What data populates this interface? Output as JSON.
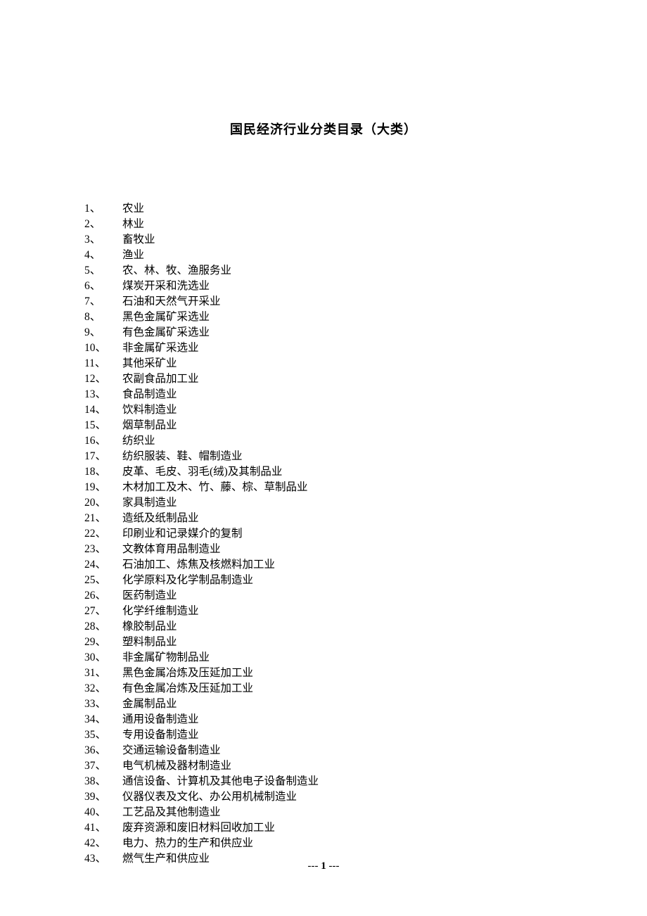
{
  "title": "国民经济行业分类目录（大类）",
  "items": [
    {
      "num": "1、",
      "label": "农业"
    },
    {
      "num": "2、",
      "label": "林业"
    },
    {
      "num": "3、",
      "label": "畜牧业"
    },
    {
      "num": "4、",
      "label": "渔业"
    },
    {
      "num": "5、",
      "label": "农、林、牧、渔服务业"
    },
    {
      "num": "6、",
      "label": "煤炭开采和洗选业"
    },
    {
      "num": "7、",
      "label": "石油和天然气开采业"
    },
    {
      "num": "8、",
      "label": "黑色金属矿采选业"
    },
    {
      "num": "9、",
      "label": "有色金属矿采选业"
    },
    {
      "num": "10、",
      "label": "非金属矿采选业"
    },
    {
      "num": "11、",
      "label": "其他采矿业"
    },
    {
      "num": "12、",
      "label": "农副食品加工业"
    },
    {
      "num": "13、",
      "label": "食品制造业"
    },
    {
      "num": "14、",
      "label": "饮料制造业"
    },
    {
      "num": "15、",
      "label": "烟草制品业"
    },
    {
      "num": "16、",
      "label": "纺织业"
    },
    {
      "num": "17、",
      "label": "纺织服装、鞋、帽制造业"
    },
    {
      "num": "18、",
      "label": "皮革、毛皮、羽毛(绒)及其制品业"
    },
    {
      "num": "19、",
      "label": "木材加工及木、竹、藤、棕、草制品业"
    },
    {
      "num": "20、",
      "label": "家具制造业"
    },
    {
      "num": "21、",
      "label": "造纸及纸制品业"
    },
    {
      "num": "22、",
      "label": "印刷业和记录媒介的复制"
    },
    {
      "num": "23、",
      "label": "文教体育用品制造业"
    },
    {
      "num": "24、",
      "label": "石油加工、炼焦及核燃料加工业"
    },
    {
      "num": "25、",
      "label": "化学原料及化学制品制造业"
    },
    {
      "num": "26、",
      "label": "医药制造业"
    },
    {
      "num": "27、",
      "label": "化学纤维制造业"
    },
    {
      "num": "28、",
      "label": "橡胶制品业"
    },
    {
      "num": "29、",
      "label": "塑料制品业"
    },
    {
      "num": "30、",
      "label": "非金属矿物制品业"
    },
    {
      "num": "31、",
      "label": "黑色金属冶炼及压延加工业"
    },
    {
      "num": "32、",
      "label": "有色金属冶炼及压延加工业"
    },
    {
      "num": "33、",
      "label": "金属制品业"
    },
    {
      "num": "34、",
      "label": "通用设备制造业"
    },
    {
      "num": "35、",
      "label": "专用设备制造业"
    },
    {
      "num": "36、",
      "label": "交通运输设备制造业"
    },
    {
      "num": "37、",
      "label": "电气机械及器材制造业"
    },
    {
      "num": "38、",
      "label": "通信设备、计算机及其他电子设备制造业"
    },
    {
      "num": "39、",
      "label": "仪器仪表及文化、办公用机械制造业"
    },
    {
      "num": "40、",
      "label": "工艺品及其他制造业"
    },
    {
      "num": "41、",
      "label": "废弃资源和废旧材料回收加工业"
    },
    {
      "num": "42、",
      "label": "电力、热力的生产和供应业"
    },
    {
      "num": "43、",
      "label": "燃气生产和供应业"
    }
  ],
  "footer": {
    "left": "--- ",
    "page": "1",
    "right": " ---"
  }
}
